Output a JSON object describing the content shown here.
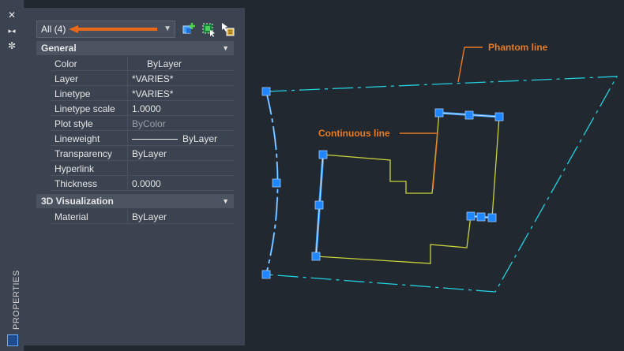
{
  "side_strip": {
    "close_icon": "✕",
    "pin_icon": "▸◂",
    "settings_icon": "✼",
    "label": "PROPERTIES"
  },
  "properties": {
    "selection_filter": "All (4)",
    "toolbar_icons": [
      "quick-select-icon",
      "select-objects-icon",
      "toggle-pickadd-icon"
    ],
    "sections": [
      {
        "title": "General",
        "rows": [
          {
            "key": "Color",
            "value": "ByLayer"
          },
          {
            "key": "Layer",
            "value": "*VARIES*"
          },
          {
            "key": "Linetype",
            "value": "*VARIES*"
          },
          {
            "key": "Linetype scale",
            "value": "1.0000"
          },
          {
            "key": "Plot style",
            "value": "ByColor"
          },
          {
            "key": "Lineweight",
            "value": "ByLayer"
          },
          {
            "key": "Transparency",
            "value": "ByLayer"
          },
          {
            "key": "Hyperlink",
            "value": ""
          },
          {
            "key": "Thickness",
            "value": "0.0000"
          }
        ]
      },
      {
        "title": "3D Visualization",
        "rows": [
          {
            "key": "Material",
            "value": "ByLayer"
          }
        ]
      }
    ]
  },
  "drawing": {
    "annotations": {
      "phantom": "Phantom line",
      "continuous": "Continuous line"
    },
    "colors": {
      "phantom": "#22d1e0",
      "continuous": "#c9d33a",
      "selected": "#3a9cff",
      "grip": "#1e86ff",
      "annotation": "#e87a22"
    }
  }
}
